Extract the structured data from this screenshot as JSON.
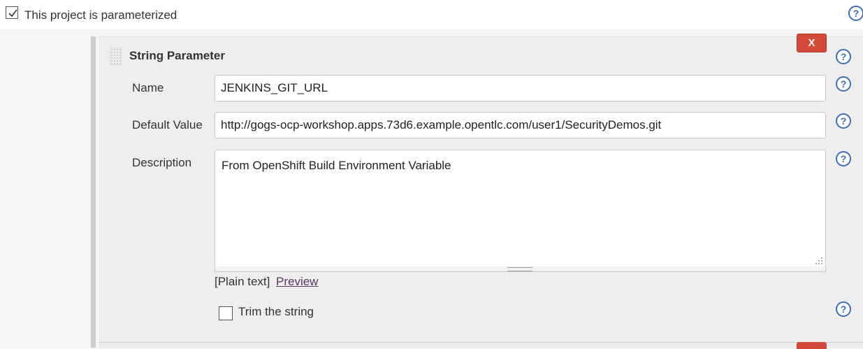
{
  "parameterized": {
    "checked": true,
    "label": "This project is parameterized"
  },
  "parameter": {
    "title": "String Parameter",
    "delete_label": "X",
    "name_label": "Name",
    "name_value": "JENKINS_GIT_URL",
    "default_label": "Default Value",
    "default_value": "http://gogs-ocp-workshop.apps.73d6.example.opentlc.com/user1/SecurityDemos.git",
    "description_label": "Description",
    "description_value": "From OpenShift Build Environment Variable",
    "format_text": "[Plain text]",
    "preview_link": "Preview",
    "trim_label": "Trim the string",
    "trim_checked": false
  },
  "colors": {
    "accent_help": "#3b6fb6",
    "delete_red": "#d24939",
    "link_visited": "#5c3566"
  },
  "icons": [
    "checkbox-checked-icon",
    "help-icon",
    "drag-handle-icon",
    "resize-grip-icon"
  ]
}
